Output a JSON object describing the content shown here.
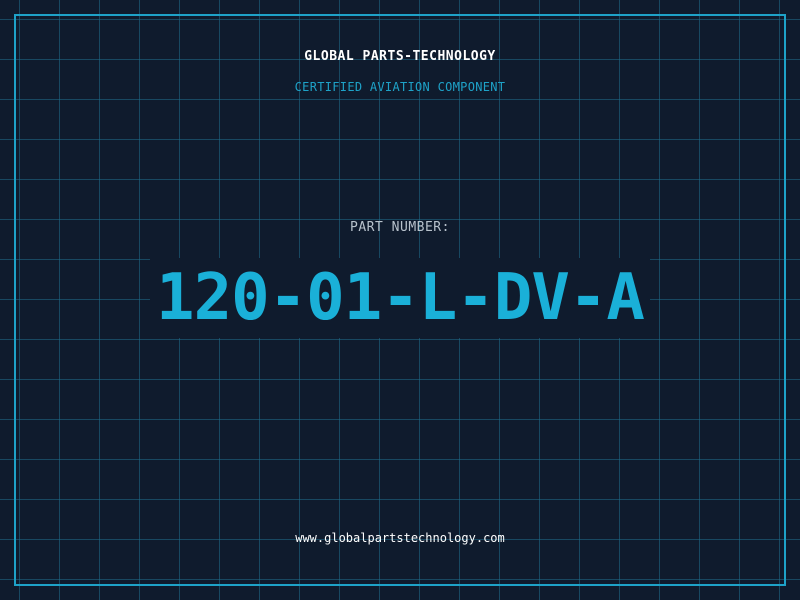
{
  "header": {
    "brand": "GLOBAL PARTS-TECHNOLOGY",
    "subtitle": "CERTIFIED AVIATION COMPONENT"
  },
  "part": {
    "label": "PART NUMBER:",
    "number": "120-01-L-DV-A"
  },
  "footer": {
    "url": "www.globalpartstechnology.com"
  },
  "colors": {
    "background": "#0f1b2d",
    "accent": "#1ea2c8",
    "grid": "#1f6e8c"
  }
}
